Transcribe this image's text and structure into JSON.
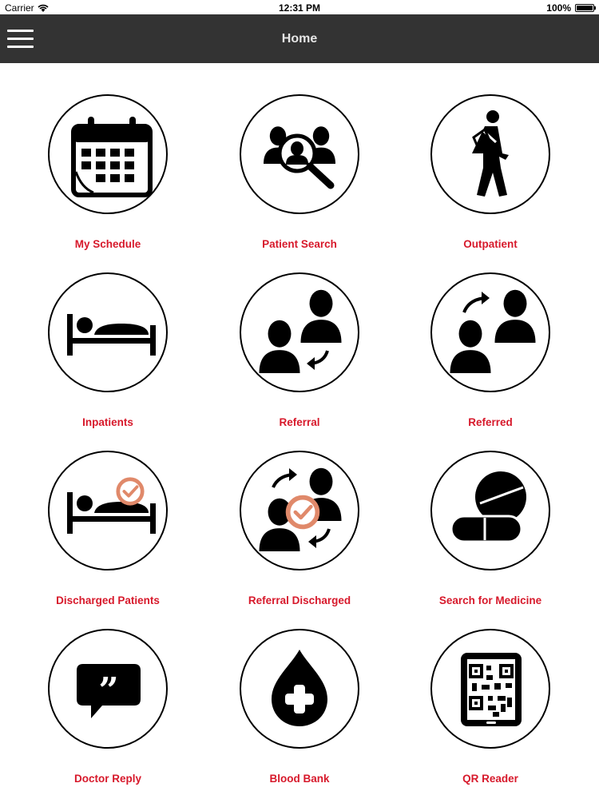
{
  "status_bar": {
    "carrier": "Carrier",
    "time": "12:31 PM",
    "battery": "100%",
    "battery_level": 1.0
  },
  "nav": {
    "title": "Home",
    "menu_icon": "hamburger-menu-icon"
  },
  "colors": {
    "nav_background": "#333333",
    "label": "#d7192b",
    "check_accent": "#e0896a"
  },
  "tiles": [
    {
      "label": "My Schedule",
      "icon": "calendar-icon"
    },
    {
      "label": "Patient Search",
      "icon": "patient-search-icon"
    },
    {
      "label": "Outpatient",
      "icon": "walking-patient-icon"
    },
    {
      "label": "Inpatients",
      "icon": "bed-icon"
    },
    {
      "label": "Referral",
      "icon": "referral-icon"
    },
    {
      "label": "Referred",
      "icon": "referred-icon"
    },
    {
      "label": "Discharged Patients",
      "icon": "discharged-bed-icon"
    },
    {
      "label": "Referral Discharged",
      "icon": "referral-discharged-icon"
    },
    {
      "label": "Search for Medicine",
      "icon": "medicine-pills-icon"
    },
    {
      "label": "Doctor Reply",
      "icon": "chat-quote-icon"
    },
    {
      "label": "Blood Bank",
      "icon": "blood-drop-icon"
    },
    {
      "label": "QR Reader",
      "icon": "qr-phone-icon"
    }
  ]
}
